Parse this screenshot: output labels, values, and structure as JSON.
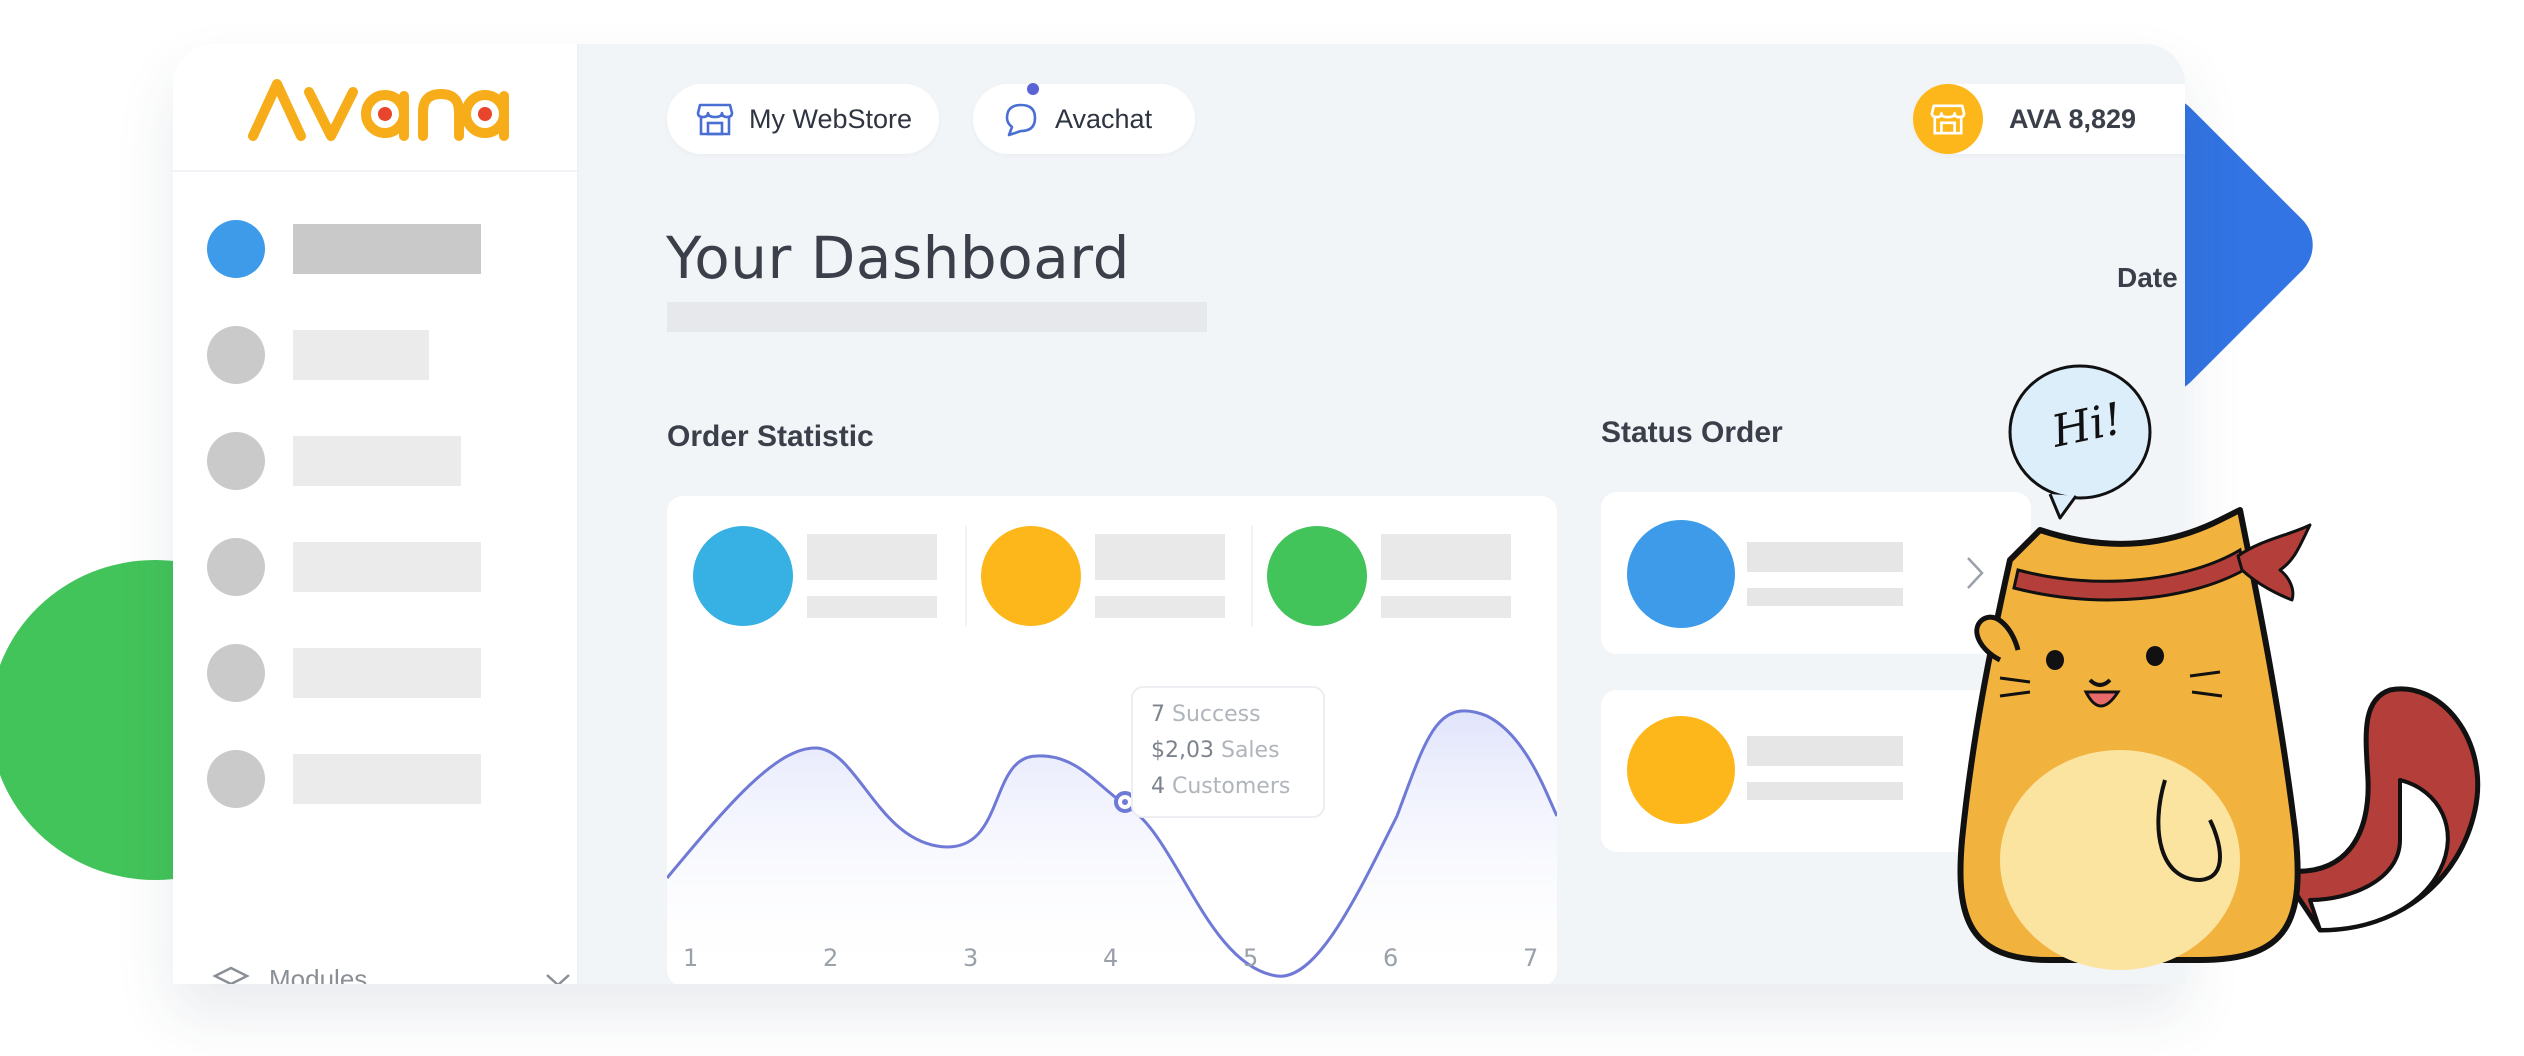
{
  "brand": {
    "logo_text": "avana",
    "accent": "#f7ac19",
    "dot_color": "#e8452c"
  },
  "topbar": {
    "webstore_label": "My WebStore",
    "avachat_label": "Avachat",
    "balance_label": "AVA 8,829"
  },
  "page": {
    "title": "Your Dashboard",
    "date_label": "Date"
  },
  "sidebar": {
    "modules_label": "Modules",
    "active_color": "#3d9be9"
  },
  "order_statistic": {
    "title": "Order Statistic",
    "stat_colors": [
      "#37b0e3",
      "#fdb71b",
      "#43c45a"
    ],
    "tooltip": {
      "success_value": "7",
      "success_label": "Success",
      "sales_value": "$2,03",
      "sales_label": "Sales",
      "customers_value": "4",
      "customers_label": "Customers"
    }
  },
  "chart_data": {
    "type": "area",
    "x": [
      1,
      2,
      3,
      4,
      5,
      6,
      7
    ],
    "tick_labels": [
      "1",
      "2",
      "3",
      "4",
      "5",
      "6",
      "7"
    ],
    "line_color": "#6f79d6",
    "grid": false
  },
  "status_order": {
    "title": "Status Order",
    "card_colors": [
      "#3d9be9",
      "#fdb71b"
    ]
  },
  "mascot": {
    "speech": "Hi!"
  }
}
